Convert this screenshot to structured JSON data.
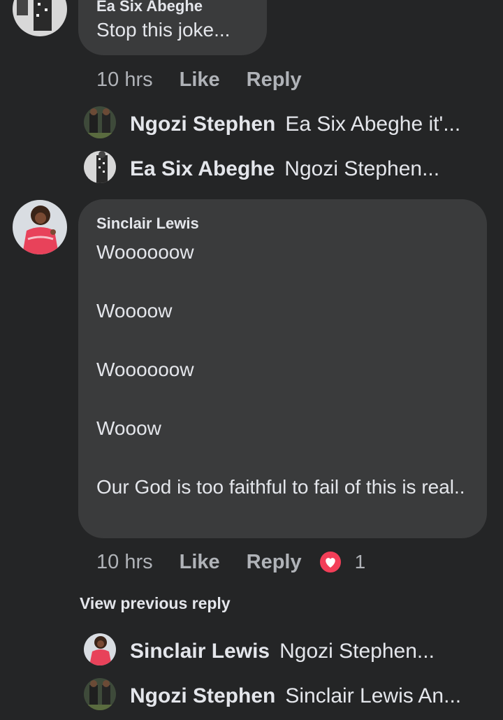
{
  "top_comment": {
    "author": "Ea Six Abeghe",
    "text": "Stop this joke...",
    "time": "10 hrs",
    "like_label": "Like",
    "reply_label": "Reply"
  },
  "top_replies": [
    {
      "name": "Ngozi Stephen",
      "text": "Ea Six Abeghe it'..."
    },
    {
      "name": "Ea Six Abeghe",
      "text": "Ngozi Stephen..."
    }
  ],
  "main_comment": {
    "author": "Sinclair Lewis",
    "text": "Woooooow\n\nWoooow\n\nWoooooow\n\nWooow\n\nOur God is too faithful to fail of this is real..",
    "time": "10 hrs",
    "like_label": "Like",
    "reply_label": "Reply",
    "reaction_icon": "heart-icon",
    "reaction_color": "#f33e58",
    "reaction_count": "1"
  },
  "view_previous_label": "View previous reply",
  "main_replies": [
    {
      "name": "Sinclair Lewis",
      "text": "Ngozi Stephen..."
    },
    {
      "name": "Ngozi Stephen",
      "text": "Sinclair Lewis An..."
    }
  ]
}
